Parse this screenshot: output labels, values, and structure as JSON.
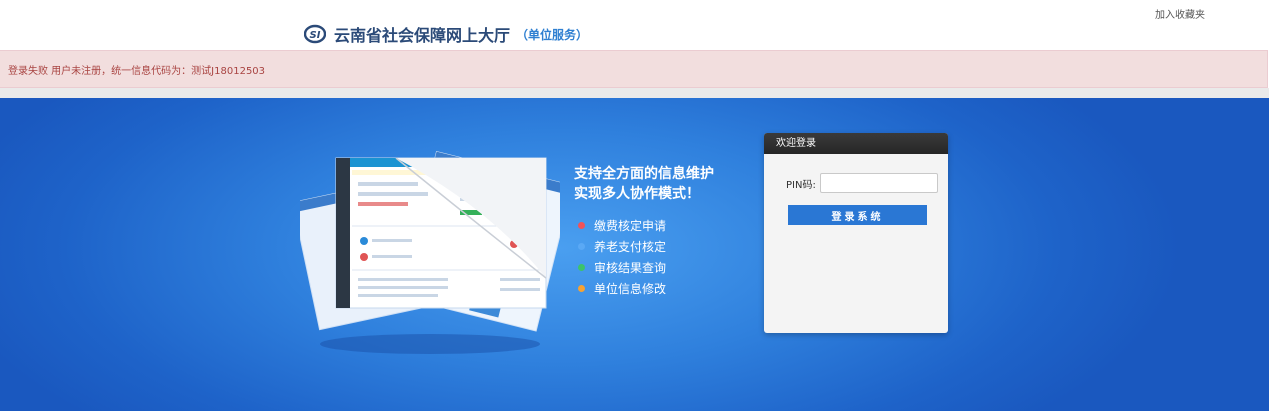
{
  "header": {
    "favorite_label": "加入收藏夹",
    "logo_title": "云南省社会保障网上大厅",
    "logo_subtitle": "（单位服务）",
    "brand_color": "#2b4a78"
  },
  "alert": {
    "message": "登录失败 用户未注册，统一信息代码为：测试J18012503",
    "color": "#a94442"
  },
  "hero": {
    "slogan_line1": "支持全方面的信息维护",
    "slogan_line2": "实现多人协作模式！",
    "features": [
      {
        "label": "缴费核定申请",
        "color": "#f0535a"
      },
      {
        "label": "养老支付核定",
        "color": "#5aa9f5"
      },
      {
        "label": "审核结果查询",
        "color": "#3cc36a"
      },
      {
        "label": "单位信息修改",
        "color": "#f5a233"
      }
    ]
  },
  "login": {
    "title": "欢迎登录",
    "pin_label": "PIN码:",
    "pin_value": "",
    "button_label": "登录系统"
  }
}
